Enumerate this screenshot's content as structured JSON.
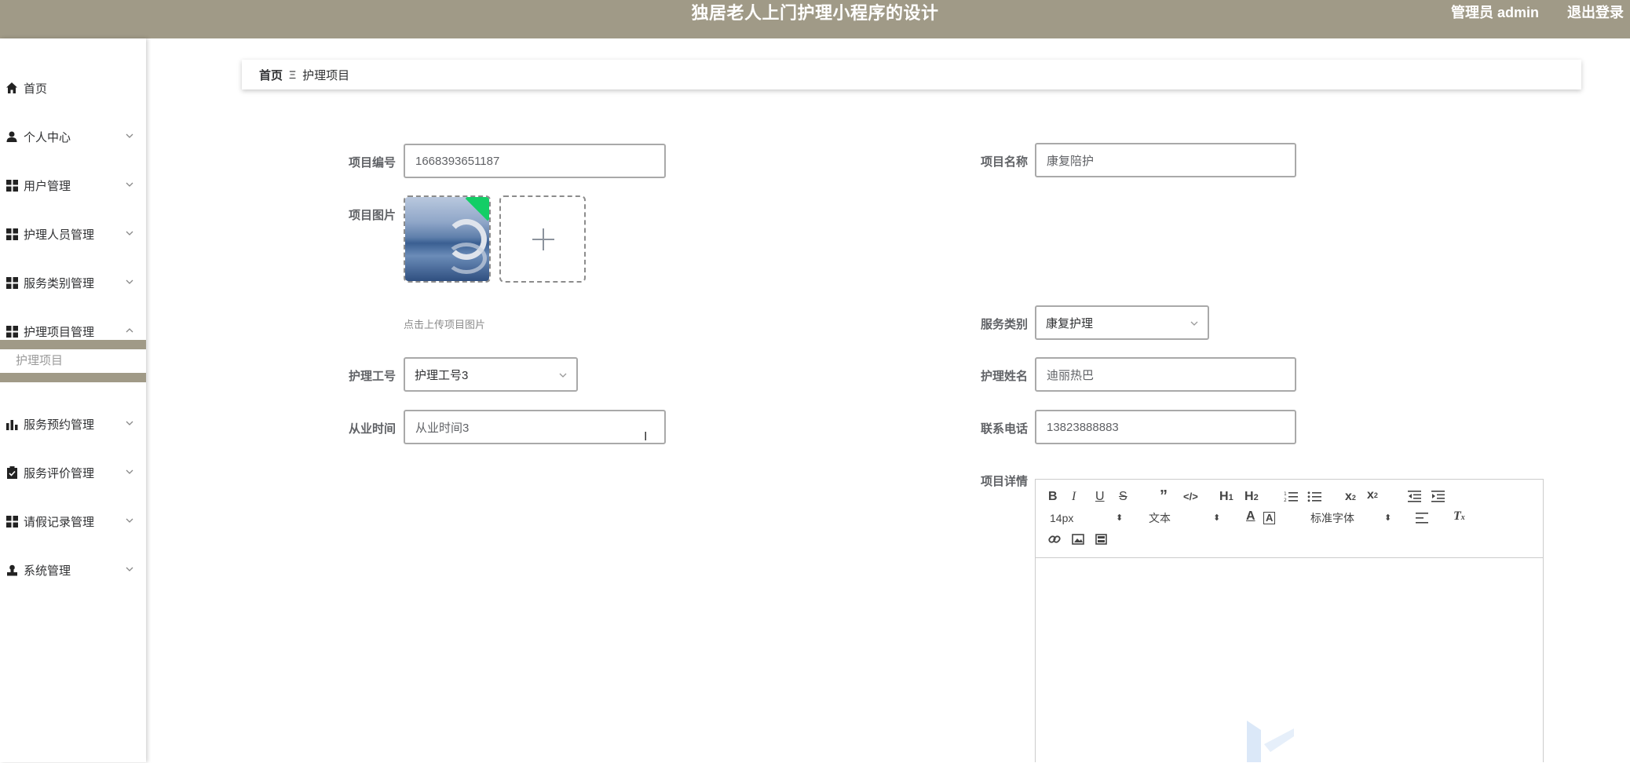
{
  "header": {
    "title": "独居老人上门护理小程序的设计",
    "user": "管理员 admin",
    "logout": "退出登录"
  },
  "sidebar": {
    "items": [
      {
        "label": "首页",
        "icon": "home-icon"
      },
      {
        "label": "个人中心",
        "icon": "person-icon"
      },
      {
        "label": "用户管理",
        "icon": "grid-icon"
      },
      {
        "label": "护理人员管理",
        "icon": "grid-icon"
      },
      {
        "label": "服务类别管理",
        "icon": "grid-icon"
      },
      {
        "label": "护理项目管理",
        "icon": "grid-icon"
      },
      {
        "label": "服务预约管理",
        "icon": "bar-chart-icon"
      },
      {
        "label": "服务评价管理",
        "icon": "clipboard-icon"
      },
      {
        "label": "请假记录管理",
        "icon": "grid-icon"
      },
      {
        "label": "系统管理",
        "icon": "user-admin-icon"
      }
    ],
    "sub_item": "护理项目"
  },
  "breadcrumb": {
    "home": "首页",
    "separator": "Ξ",
    "current": "护理项目"
  },
  "form": {
    "project_no_label": "项目编号",
    "project_no_value": "1668393651187",
    "project_name_label": "项目名称",
    "project_name_value": "康复陪护",
    "project_image_label": "项目图片",
    "upload_tip": "点击上传项目图片",
    "service_category_label": "服务类别",
    "service_category_value": "康复护理",
    "nurse_no_label": "护理工号",
    "nurse_no_value": "护理工号3",
    "nurse_name_label": "护理姓名",
    "nurse_name_value": "迪丽热巴",
    "work_time_label": "从业时间",
    "work_time_value": "从业时间3",
    "phone_label": "联系电话",
    "phone_value": "13823888883",
    "details_label": "项目详情"
  },
  "editor": {
    "font_size": "14px",
    "header_select": "文本",
    "font_family": "标准字体"
  },
  "colors": {
    "header_bg": "#a09a87",
    "upload_badge": "#13ce66"
  }
}
